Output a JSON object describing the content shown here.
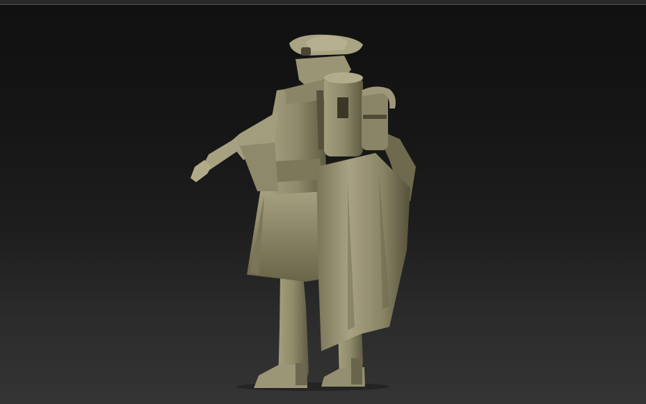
{
  "viewport": {
    "background_top": "#111111",
    "background_bottom": "#343434",
    "border_color": "#555555"
  },
  "model": {
    "material_base": "#8f8a6a",
    "material_light": "#b3ad8c",
    "material_shadow": "#4e4a34",
    "material_dark": "#2a281c"
  }
}
